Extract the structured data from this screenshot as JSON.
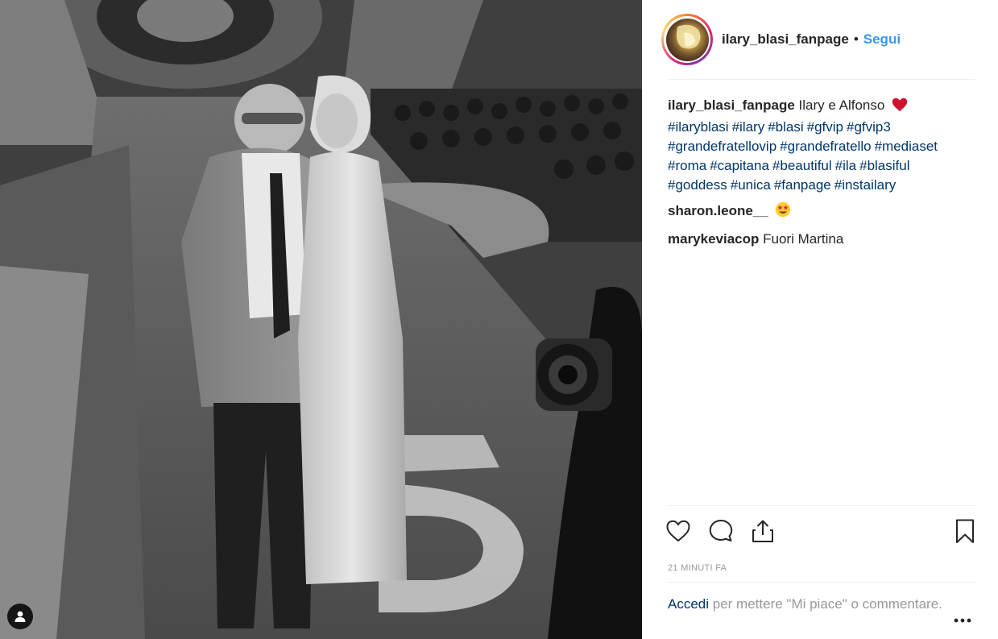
{
  "header": {
    "username": "ilary_blasi_fanpage",
    "separator": "•",
    "follow_label": "Segui"
  },
  "caption": {
    "username": "ilary_blasi_fanpage",
    "text": "Ilary e Alfonso",
    "emoji": "red-heart-icon",
    "hashtags": [
      "#ilaryblasi",
      "#ilary",
      "#blasi",
      "#gfvip",
      "#gfvip3",
      "#grandefratellovip",
      "#grandefratello",
      "#mediaset",
      "#roma",
      "#capitana",
      "#beautiful",
      "#ila",
      "#blasiful",
      "#goddess",
      "#unica",
      "#fanpage",
      "#instailary"
    ]
  },
  "comments": [
    {
      "username": "sharon.leone__",
      "text": "",
      "emoji": "star-struck-icon"
    },
    {
      "username": "marykeviacop",
      "text": "Fuori Martina"
    }
  ],
  "actions": {
    "icons": [
      "heart-icon",
      "comment-icon",
      "share-icon",
      "bookmark-icon"
    ]
  },
  "timestamp": "21 MINUTI FA",
  "footer": {
    "login_link": "Accedi",
    "login_text": " per mettere \"Mi piace\" o commentare.",
    "more_icon": "more-options-icon"
  },
  "colors": {
    "link_blue": "#3897f0",
    "hashtag_blue": "#003569",
    "muted_gray": "#999999",
    "heart_red": "#d1122e"
  }
}
